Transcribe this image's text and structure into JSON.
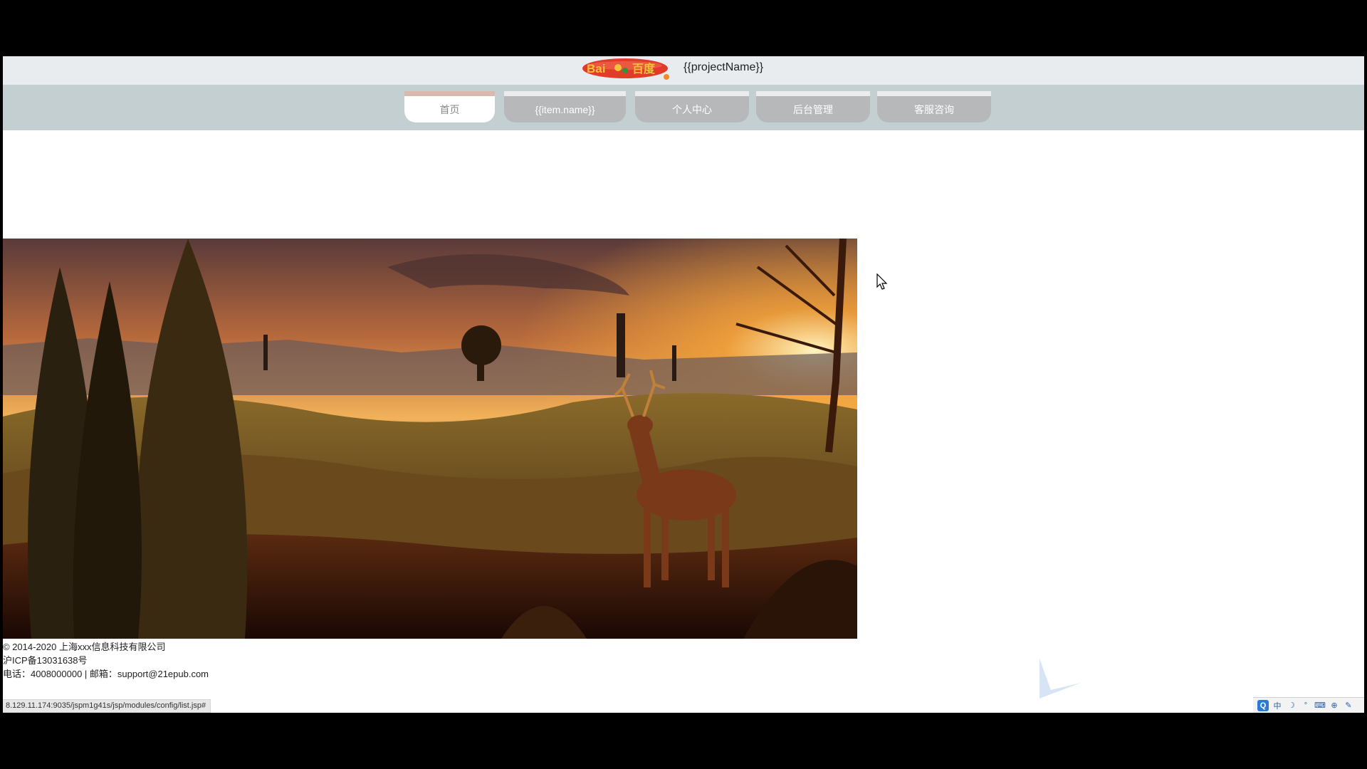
{
  "header": {
    "project_name": "{{projectName}}",
    "logo_name": "baidu-logo"
  },
  "nav": {
    "tabs": [
      {
        "label": "首页",
        "active": true
      },
      {
        "label": "{{item.name}}",
        "active": false
      },
      {
        "label": "个人中心",
        "active": false
      },
      {
        "label": "后台管理",
        "active": false
      },
      {
        "label": "客服咨询",
        "active": false
      }
    ]
  },
  "banner": {
    "subject": "deer-sunset-landscape"
  },
  "footer": {
    "copyright": "© 2014-2020 上海xxx信息科技有限公司",
    "icp": "沪ICP备13031638号",
    "contact": "电话：4008000000 | 邮箱：support@21epub.com"
  },
  "status_bar": {
    "url": "8.129.11.174:9035/jspm1g41s/jsp/modules/config/list.jsp#"
  },
  "tray": {
    "items": [
      "Q",
      "中",
      "☽",
      "°",
      "⌨",
      "⊕",
      "✎"
    ]
  },
  "colors": {
    "nav_bg": "#c3cfd0",
    "tab_bg": "#b6b8b9",
    "topbar_bg": "#e9ecee"
  }
}
